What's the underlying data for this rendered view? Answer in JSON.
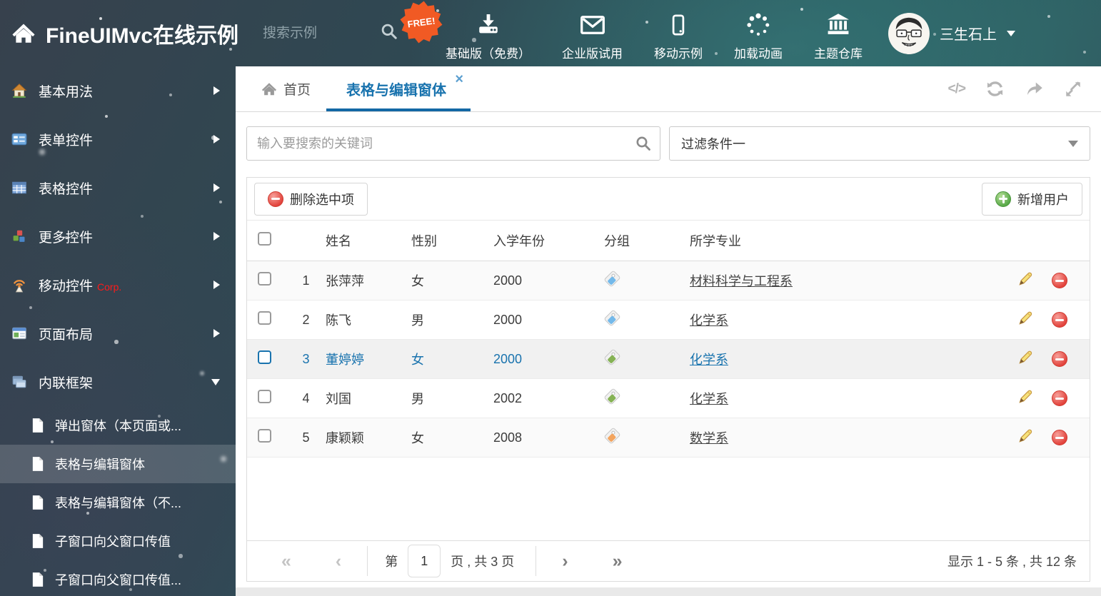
{
  "header": {
    "title": "FineUIMvc在线示例",
    "search_placeholder": "搜索示例",
    "free_badge": "FREE!",
    "actions": [
      {
        "label": "基础版（免费）"
      },
      {
        "label": "企业版试用"
      },
      {
        "label": "移动示例"
      },
      {
        "label": "加载动画"
      },
      {
        "label": "主题仓库"
      }
    ],
    "user_name": "三生石上"
  },
  "sidebar": {
    "items": [
      {
        "label": "基本用法"
      },
      {
        "label": "表单控件"
      },
      {
        "label": "表格控件"
      },
      {
        "label": "更多控件"
      },
      {
        "label": "移动控件",
        "badge": "Corp."
      },
      {
        "label": "页面布局"
      },
      {
        "label": "内联框架"
      }
    ],
    "subitems": [
      {
        "label": "弹出窗体（本页面或..."
      },
      {
        "label": "表格与编辑窗体"
      },
      {
        "label": "表格与编辑窗体（不..."
      },
      {
        "label": "子窗口向父窗口传值"
      },
      {
        "label": "子窗口向父窗口传值..."
      }
    ]
  },
  "tabs": {
    "home": "首页",
    "active": "表格与编辑窗体"
  },
  "filters": {
    "search_placeholder": "输入要搜索的关键词",
    "filter_value": "过滤条件一"
  },
  "toolbar": {
    "delete_label": "删除选中项",
    "add_label": "新增用户"
  },
  "table": {
    "columns": [
      "姓名",
      "性别",
      "入学年份",
      "分组",
      "所学专业"
    ],
    "rows": [
      {
        "index": "1",
        "name": "张萍萍",
        "gender": "女",
        "year": "2000",
        "tag": "blue",
        "major": "材料科学与工程系",
        "selected": false
      },
      {
        "index": "2",
        "name": "陈飞",
        "gender": "男",
        "year": "2000",
        "tag": "blue",
        "major": "化学系",
        "selected": false
      },
      {
        "index": "3",
        "name": "董婷婷",
        "gender": "女",
        "year": "2000",
        "tag": "green",
        "major": "化学系",
        "selected": true
      },
      {
        "index": "4",
        "name": "刘国",
        "gender": "男",
        "year": "2002",
        "tag": "green",
        "major": "化学系",
        "selected": false
      },
      {
        "index": "5",
        "name": "康颖颖",
        "gender": "女",
        "year": "2008",
        "tag": "orange",
        "major": "数学系",
        "selected": false
      }
    ]
  },
  "pagination": {
    "prefix": "第",
    "current_page": "1",
    "suffix": "页 , 共 3 页",
    "first": "«",
    "prev": "‹",
    "next": "›",
    "last": "»",
    "summary": "显示 1 - 5 条 , 共 12 条"
  },
  "colors": {
    "accent_blue": "#1973ae",
    "danger_red": "#e2433c",
    "success_green": "#58a948",
    "tag_blue": "#74b9ea",
    "tag_green": "#85b254",
    "tag_orange": "#f3a45e",
    "free_badge_orange": "#f15a24",
    "corp_red": "#ff1a1a"
  }
}
